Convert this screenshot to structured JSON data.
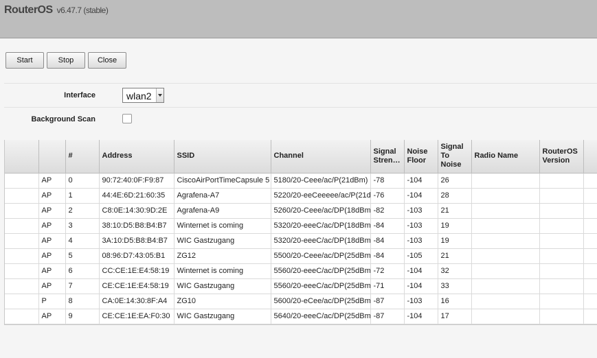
{
  "brand": {
    "name": "RouterOS",
    "version": "v6.47.7 (stable)"
  },
  "toolbar": {
    "start_label": "Start",
    "stop_label": "Stop",
    "close_label": "Close"
  },
  "form": {
    "interface_label": "Interface",
    "interface_value": "wlan2",
    "background_scan_label": "Background Scan",
    "background_scan_checked": false
  },
  "table": {
    "columns": [
      "",
      "",
      "#",
      "Address",
      "SSID",
      "Channel",
      "Signal Stren…",
      "Noise Floor",
      "Signal To Noise",
      "Radio Name",
      "RouterOS Version",
      ""
    ],
    "rows": [
      {
        "flag": "AP",
        "num": "0",
        "address": "90:72:40:0F:F9:87",
        "ssid": "CiscoAirPortTimeCapsule 5",
        "channel": "5180/20-Ceee/ac/P(21dBm)",
        "signal": "-78",
        "noise": "-104",
        "snr": "26",
        "radio": "",
        "ros": ""
      },
      {
        "flag": "AP",
        "num": "1",
        "address": "44:4E:6D:21:60:35",
        "ssid": "Agrafena-A7",
        "channel": "5220/20-eeCeeeee/ac/P(21d",
        "signal": "-76",
        "noise": "-104",
        "snr": "28",
        "radio": "",
        "ros": ""
      },
      {
        "flag": "AP",
        "num": "2",
        "address": "C8:0E:14:30:9D:2E",
        "ssid": "Agrafena-A9",
        "channel": "5260/20-Ceee/ac/DP(18dBm",
        "signal": "-82",
        "noise": "-103",
        "snr": "21",
        "radio": "",
        "ros": ""
      },
      {
        "flag": "AP",
        "num": "3",
        "address": "38:10:D5:B8:B4:B7",
        "ssid": "Winternet is coming",
        "channel": "5320/20-eeeC/ac/DP(18dBm",
        "signal": "-84",
        "noise": "-103",
        "snr": "19",
        "radio": "",
        "ros": ""
      },
      {
        "flag": "AP",
        "num": "4",
        "address": "3A:10:D5:B8:B4:B7",
        "ssid": "WIC Gastzugang",
        "channel": "5320/20-eeeC/ac/DP(18dBm",
        "signal": "-84",
        "noise": "-103",
        "snr": "19",
        "radio": "",
        "ros": ""
      },
      {
        "flag": "AP",
        "num": "5",
        "address": "08:96:D7:43:05:B1",
        "ssid": "ZG12",
        "channel": "5500/20-Ceee/ac/DP(25dBm",
        "signal": "-84",
        "noise": "-105",
        "snr": "21",
        "radio": "",
        "ros": ""
      },
      {
        "flag": "AP",
        "num": "6",
        "address": "CC:CE:1E:E4:58:19",
        "ssid": "Winternet is coming",
        "channel": "5560/20-eeeC/ac/DP(25dBm",
        "signal": "-72",
        "noise": "-104",
        "snr": "32",
        "radio": "",
        "ros": ""
      },
      {
        "flag": "AP",
        "num": "7",
        "address": "CE:CE:1E:E4:58:19",
        "ssid": "WIC Gastzugang",
        "channel": "5560/20-eeeC/ac/DP(25dBm",
        "signal": "-71",
        "noise": "-104",
        "snr": "33",
        "radio": "",
        "ros": ""
      },
      {
        "flag": "P",
        "num": "8",
        "address": "CA:0E:14:30:8F:A4",
        "ssid": "ZG10",
        "channel": "5600/20-eCee/ac/DP(25dBm",
        "signal": "-87",
        "noise": "-103",
        "snr": "16",
        "radio": "",
        "ros": ""
      },
      {
        "flag": "AP",
        "num": "9",
        "address": "CE:CE:1E:EA:F0:30",
        "ssid": "WIC Gastzugang",
        "channel": "5640/20-eeeC/ac/DP(25dBm",
        "signal": "-87",
        "noise": "-104",
        "snr": "17",
        "radio": "",
        "ros": ""
      }
    ]
  }
}
